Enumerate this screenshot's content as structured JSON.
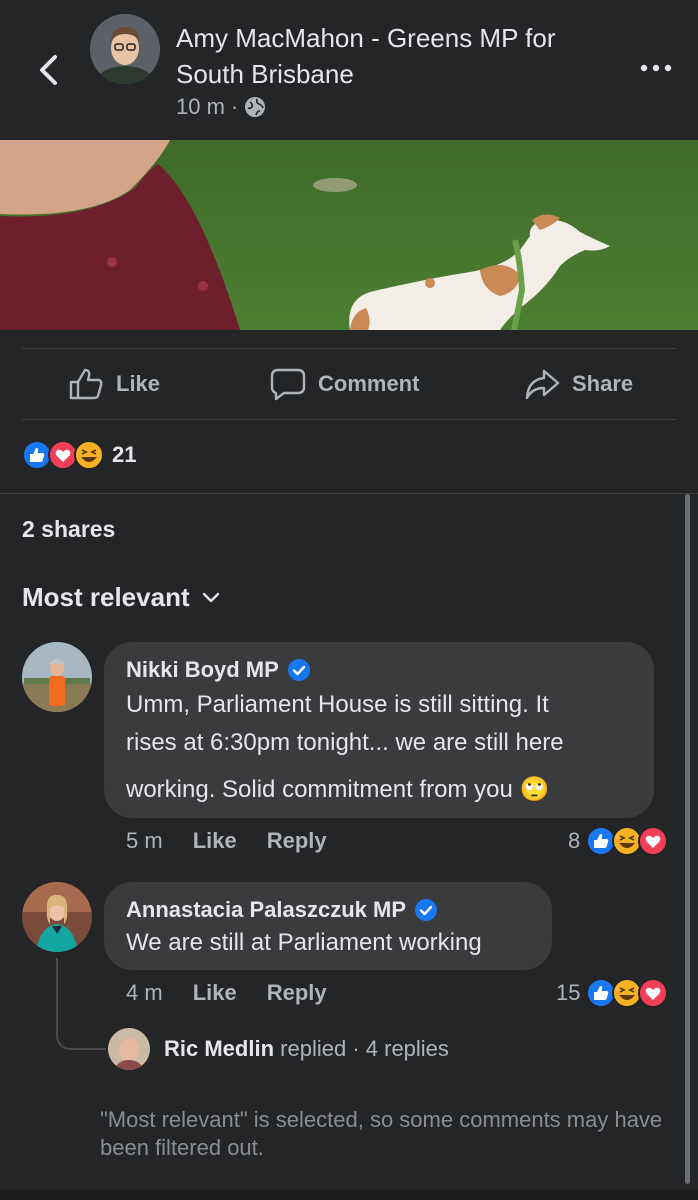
{
  "header": {
    "poster_name": "Amy MacMahon - Greens MP for South Brisbane",
    "time": "10 m",
    "separator": "·"
  },
  "actions": {
    "like": "Like",
    "comment": "Comment",
    "share": "Share"
  },
  "post_stats": {
    "reaction_count": "21",
    "shares": "2 shares"
  },
  "sort": {
    "label": "Most relevant"
  },
  "comments": [
    {
      "name": "Nikki Boyd MP",
      "text_line1": "Umm, Parliament House is still sitting. It",
      "text_line2": "rises at 6:30pm tonight... we are still here",
      "text_line3": "working. Solid commitment from you",
      "emoji": "🙄",
      "time": "5 m",
      "like": "Like",
      "reply": "Reply",
      "reaction_count": "8"
    },
    {
      "name": "Annastacia Palaszczuk MP",
      "text_line1": "We are still at Parliament working",
      "time": "4 m",
      "like": "Like",
      "reply": "Reply",
      "reaction_count": "15"
    }
  ],
  "reply_thread": {
    "name": "Ric Medlin",
    "action": "replied",
    "separator": "·",
    "count": "4 replies"
  },
  "footnote": "\"Most relevant\" is selected, so some comments may have been filtered out.",
  "colors": {
    "background": "#242526",
    "bubble": "#3a3b3c",
    "like_blue": "#1877f2",
    "love_red": "#f33e58",
    "haha_yellow": "#f7b125",
    "verified_blue": "#1877f2"
  }
}
